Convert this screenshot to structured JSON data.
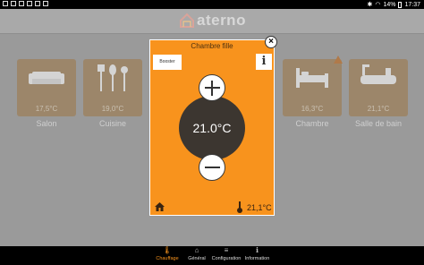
{
  "status_bar": {
    "battery": "14%",
    "time": "17:37"
  },
  "app": {
    "name": "aterno"
  },
  "rooms": [
    {
      "name": "Salon",
      "temp": "17,5°C",
      "icon": "sofa-icon"
    },
    {
      "name": "Cuisine",
      "temp": "19,0°C",
      "icon": "kitchen-utensils-icon"
    },
    {
      "name": "Chambre",
      "temp": "16,3°C",
      "icon": "bed-icon"
    },
    {
      "name": "Salle de bain",
      "temp": "21,1°C",
      "icon": "bathtub-icon"
    }
  ],
  "modal": {
    "title": "Chambre fille",
    "booster_label": "Booster",
    "info_label": "i",
    "close_label": "×",
    "setpoint": "21.0°C",
    "room_temperature": "21,1°C"
  },
  "bottom_nav": [
    {
      "label": "Chauffage",
      "icon": "thermometer-icon",
      "active": true
    },
    {
      "label": "Général",
      "icon": "home-icon",
      "active": false
    },
    {
      "label": "Configuration",
      "icon": "menu-icon",
      "active": false
    },
    {
      "label": "Information",
      "icon": "info-icon",
      "active": false
    }
  ],
  "colors": {
    "accent": "#f8931d",
    "dial": "#3c3630",
    "overlay": "#9a9a9a"
  }
}
